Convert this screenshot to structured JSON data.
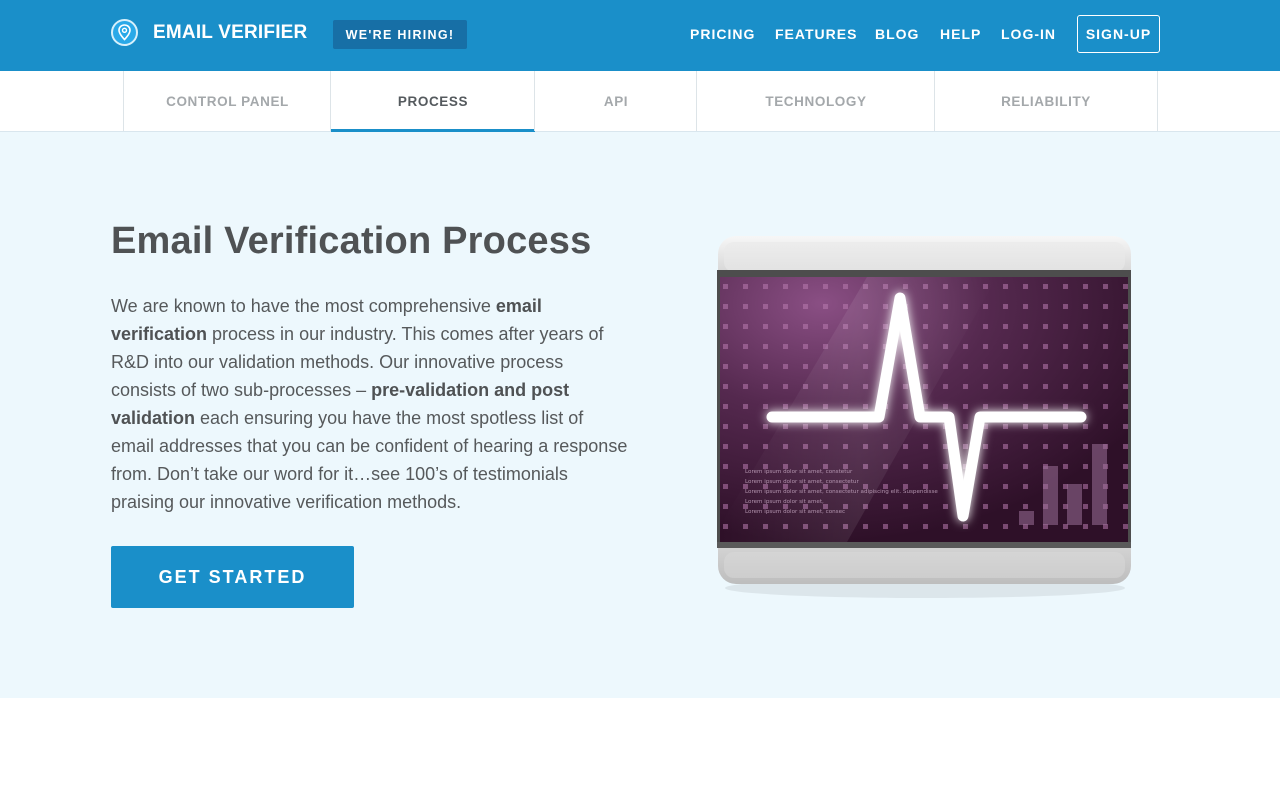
{
  "header": {
    "logo_text": "EMAIL VERIFIER",
    "hiring_label": "WE'RE HIRING!",
    "nav": [
      "PRICING",
      "FEATURES",
      "BLOG",
      "HELP",
      "LOG-IN"
    ],
    "signup_label": "SIGN-UP"
  },
  "tabs": [
    "CONTROL PANEL",
    "PROCESS",
    "API",
    "TECHNOLOGY",
    "RELIABILITY"
  ],
  "active_tab": "PROCESS",
  "hero": {
    "title": "Email Verification Process",
    "text_parts": [
      "We are known to have the most comprehensive ",
      "email verification",
      " process in our industry. This comes after years of R&D into our validation methods. Our innovative process consists of two sub-processes – ",
      "pre-validation and post validation",
      " each ensuring you have the most spotless list of email addresses that you can be confident of hearing a response from. Don’t take our word for it…see 100’s of testimonials praising our innovative verification methods."
    ],
    "cta_label": "GET STARTED"
  },
  "screen_text": [
    "Lorem ipsum dolor sit amet, constetur",
    "Lorem ipsum dolor sit amet, consectetur",
    "Lorem ipsum dolor sit amet, consectetur adipiscing elit. Suspendisse",
    "Lorem ipsum dolor sit amet,",
    "Lorem ipsum dolor sit amet, consec"
  ],
  "colors": {
    "brand": "#1a8fc9",
    "hero_bg": "#edf8fd",
    "hiring_bg": "#176fa6"
  },
  "icons": {
    "logo": "location-pin-icon"
  }
}
